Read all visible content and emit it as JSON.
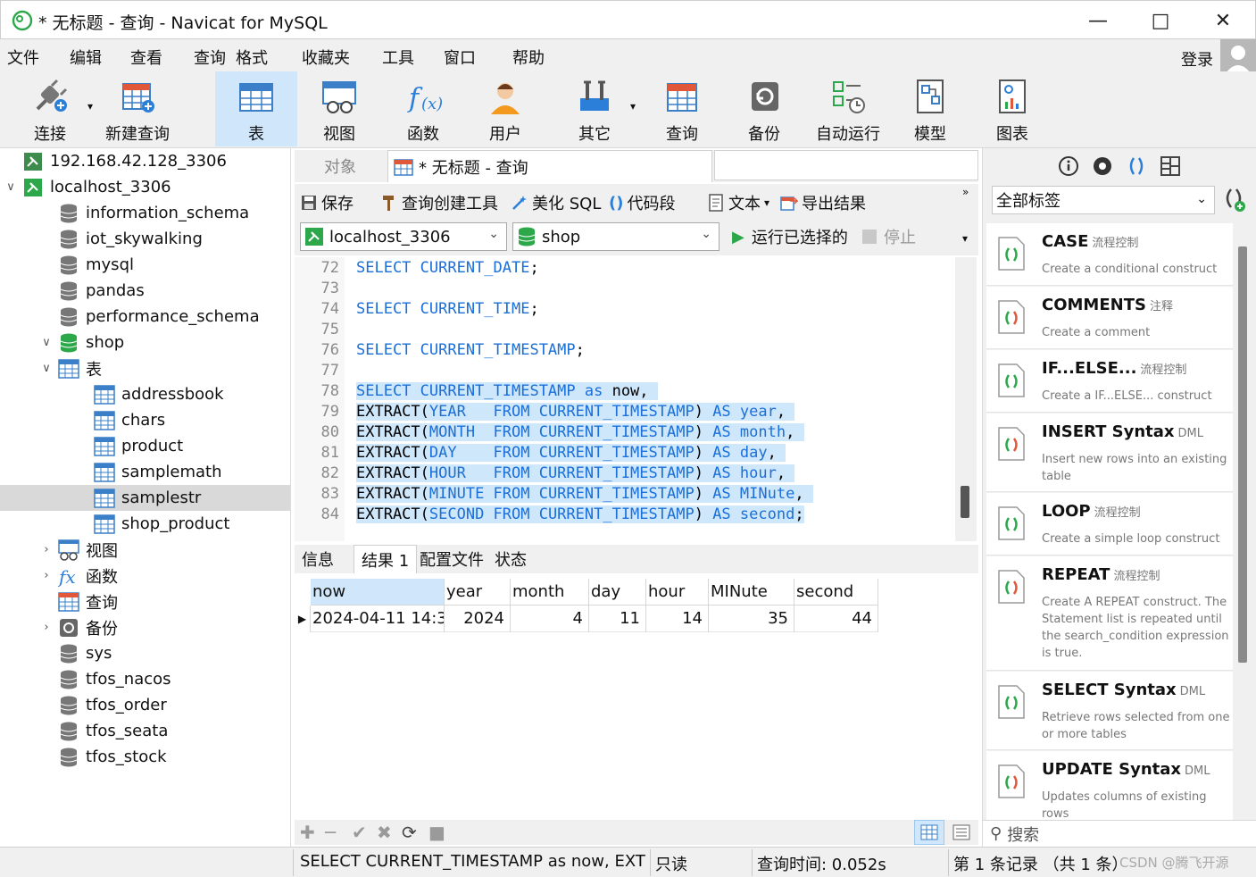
{
  "window": {
    "title": "* 无标题 - 查询 - Navicat for MySQL"
  },
  "menu": {
    "items": [
      "文件",
      "编辑",
      "查看",
      "查询",
      "格式",
      "收藏夹",
      "工具",
      "窗口",
      "帮助"
    ],
    "login": "登录"
  },
  "toolbar": {
    "items": [
      {
        "label": "连接",
        "icon": "plug-icon"
      },
      {
        "label": "新建查询",
        "icon": "new-query-icon"
      },
      {
        "label": "表",
        "icon": "table-icon",
        "active": true
      },
      {
        "label": "视图",
        "icon": "view-icon"
      },
      {
        "label": "函数",
        "icon": "function-icon"
      },
      {
        "label": "用户",
        "icon": "user-icon"
      },
      {
        "label": "其它",
        "icon": "tools-icon"
      },
      {
        "label": "查询",
        "icon": "query-icon"
      },
      {
        "label": "备份",
        "icon": "backup-icon"
      },
      {
        "label": "自动运行",
        "icon": "schedule-icon"
      },
      {
        "label": "模型",
        "icon": "model-icon"
      },
      {
        "label": "图表",
        "icon": "chart-icon"
      }
    ]
  },
  "tree": {
    "nodes": [
      {
        "label": "192.168.42.128_3306",
        "type": "connection",
        "depth": 0,
        "expander": ""
      },
      {
        "label": "localhost_3306",
        "type": "connection-open",
        "depth": 0,
        "expander": "v"
      },
      {
        "label": "information_schema",
        "type": "db",
        "depth": 1,
        "expander": ""
      },
      {
        "label": "iot_skywalking",
        "type": "db",
        "depth": 1,
        "expander": ""
      },
      {
        "label": "mysql",
        "type": "db",
        "depth": 1,
        "expander": ""
      },
      {
        "label": "pandas",
        "type": "db",
        "depth": 1,
        "expander": ""
      },
      {
        "label": "performance_schema",
        "type": "db",
        "depth": 1,
        "expander": ""
      },
      {
        "label": "shop",
        "type": "db-open",
        "depth": 1,
        "expander": "v"
      },
      {
        "label": "表",
        "type": "table-folder",
        "depth": 2,
        "expander": "v"
      },
      {
        "label": "addressbook",
        "type": "table",
        "depth": 3,
        "expander": ""
      },
      {
        "label": "chars",
        "type": "table",
        "depth": 3,
        "expander": ""
      },
      {
        "label": "product",
        "type": "table",
        "depth": 3,
        "expander": ""
      },
      {
        "label": "samplemath",
        "type": "table",
        "depth": 3,
        "expander": ""
      },
      {
        "label": "samplestr",
        "type": "table",
        "depth": 3,
        "expander": "",
        "selected": true
      },
      {
        "label": "shop_product",
        "type": "table",
        "depth": 3,
        "expander": ""
      },
      {
        "label": "视图",
        "type": "view-folder",
        "depth": 2,
        "expander": ">"
      },
      {
        "label": "函数",
        "type": "func-folder",
        "depth": 2,
        "expander": ">"
      },
      {
        "label": "查询",
        "type": "query-folder",
        "depth": 2,
        "expander": ""
      },
      {
        "label": "备份",
        "type": "backup-folder",
        "depth": 2,
        "expander": ">"
      },
      {
        "label": "sys",
        "type": "db",
        "depth": 1,
        "expander": ""
      },
      {
        "label": "tfos_nacos",
        "type": "db",
        "depth": 1,
        "expander": ""
      },
      {
        "label": "tfos_order",
        "type": "db",
        "depth": 1,
        "expander": ""
      },
      {
        "label": "tfos_seata",
        "type": "db",
        "depth": 1,
        "expander": ""
      },
      {
        "label": "tfos_stock",
        "type": "db",
        "depth": 1,
        "expander": ""
      }
    ]
  },
  "tabs": {
    "objects": "对象",
    "query": "* 无标题 - 查询"
  },
  "query_toolbar": {
    "save": "保存",
    "builder": "查询创建工具",
    "beautify": "美化 SQL",
    "snippet": "代码段",
    "text": "文本",
    "export": "导出结果",
    "connection": "localhost_3306",
    "database": "shop",
    "run_selected": "运行已选择的",
    "stop": "停止"
  },
  "editor": {
    "lines": [
      {
        "n": "72",
        "segs": [
          {
            "t": "SELECT CURRENT_DATE",
            "k": true
          },
          {
            "t": ";",
            "k": false
          }
        ],
        "hl": false
      },
      {
        "n": "73",
        "segs": [],
        "hl": false
      },
      {
        "n": "74",
        "segs": [
          {
            "t": "SELECT CURRENT_TIME",
            "k": true
          },
          {
            "t": ";",
            "k": false
          }
        ],
        "hl": false
      },
      {
        "n": "75",
        "segs": [],
        "hl": false
      },
      {
        "n": "76",
        "segs": [
          {
            "t": "SELECT CURRENT_TIMESTAMP",
            "k": true
          },
          {
            "t": ";",
            "k": false
          }
        ],
        "hl": false
      },
      {
        "n": "77",
        "segs": [],
        "hl": false
      },
      {
        "n": "78",
        "segs": [
          {
            "t": "SELECT CURRENT_TIMESTAMP as",
            "k": true
          },
          {
            "t": " now, ",
            "k": false
          }
        ],
        "hl": true
      },
      {
        "n": "79",
        "segs": [
          {
            "t": "EXTRACT(",
            "k": false
          },
          {
            "t": "YEAR   FROM CURRENT_TIMESTAMP",
            "k": true
          },
          {
            "t": ") ",
            "k": false
          },
          {
            "t": "AS year",
            "k": true
          },
          {
            "t": ", ",
            "k": false
          }
        ],
        "hl": true
      },
      {
        "n": "80",
        "segs": [
          {
            "t": "EXTRACT(",
            "k": false
          },
          {
            "t": "MONTH  FROM CURRENT_TIMESTAMP",
            "k": true
          },
          {
            "t": ") ",
            "k": false
          },
          {
            "t": "AS month",
            "k": true
          },
          {
            "t": ", ",
            "k": false
          }
        ],
        "hl": true
      },
      {
        "n": "81",
        "segs": [
          {
            "t": "EXTRACT(",
            "k": false
          },
          {
            "t": "DAY    FROM CURRENT_TIMESTAMP",
            "k": true
          },
          {
            "t": ") ",
            "k": false
          },
          {
            "t": "AS day",
            "k": true
          },
          {
            "t": ", ",
            "k": false
          }
        ],
        "hl": true
      },
      {
        "n": "82",
        "segs": [
          {
            "t": "EXTRACT(",
            "k": false
          },
          {
            "t": "HOUR   FROM CURRENT_TIMESTAMP",
            "k": true
          },
          {
            "t": ") ",
            "k": false
          },
          {
            "t": "AS hour",
            "k": true
          },
          {
            "t": ", ",
            "k": false
          }
        ],
        "hl": true
      },
      {
        "n": "83",
        "segs": [
          {
            "t": "EXTRACT(",
            "k": false
          },
          {
            "t": "MINUTE FROM CURRENT_TIMESTAMP",
            "k": true
          },
          {
            "t": ") ",
            "k": false
          },
          {
            "t": "AS MINute",
            "k": true
          },
          {
            "t": ", ",
            "k": false
          }
        ],
        "hl": true
      },
      {
        "n": "84",
        "segs": [
          {
            "t": "EXTRACT(",
            "k": false
          },
          {
            "t": "SECOND FROM CURRENT_TIMESTAMP",
            "k": true
          },
          {
            "t": ") ",
            "k": false
          },
          {
            "t": "AS second",
            "k": true
          },
          {
            "t": ";",
            "k": false
          }
        ],
        "hl": true
      }
    ]
  },
  "result_tabs": [
    "信息",
    "结果 1",
    "配置文件",
    "状态"
  ],
  "result": {
    "columns": [
      "now",
      "year",
      "month",
      "day",
      "hour",
      "MINute",
      "second"
    ],
    "rows": [
      [
        "2024-04-11 14:3",
        "2024",
        "4",
        "11",
        "14",
        "35",
        "44"
      ]
    ]
  },
  "status": {
    "sql": "SELECT CURRENT_TIMESTAMP as now, EXTRA",
    "mode": "只读",
    "time": "查询时间: 0.052s",
    "records": "第 1 条记录 （共 1 条）"
  },
  "snippets": {
    "tag_filter": "全部标签",
    "search_placeholder": "搜索",
    "items": [
      {
        "name": "CASE",
        "tag": "流程控制",
        "desc": "Create a conditional construct"
      },
      {
        "name": "COMMENTS",
        "tag": "注释",
        "desc": "Create a comment"
      },
      {
        "name": "IF...ELSE...",
        "tag": "流程控制",
        "desc": "Create a IF...ELSE... construct"
      },
      {
        "name": "INSERT Syntax",
        "tag": "DML",
        "desc": "Insert new rows into an existing table"
      },
      {
        "name": "LOOP",
        "tag": "流程控制",
        "desc": "Create a simple loop construct"
      },
      {
        "name": "REPEAT",
        "tag": "流程控制",
        "desc": "Create A REPEAT construct. The Statement list is repeated until the search_condition expression is true."
      },
      {
        "name": "SELECT Syntax",
        "tag": "DML",
        "desc": "Retrieve rows selected from one or more tables"
      },
      {
        "name": "UPDATE Syntax",
        "tag": "DML",
        "desc": "Updates columns of existing rows"
      }
    ]
  },
  "watermark": "CSDN @腾飞开源",
  "colors": {
    "accent": "#1a6fd8",
    "selection": "#cfe7fb",
    "navicat_green": "#2ca84a"
  }
}
